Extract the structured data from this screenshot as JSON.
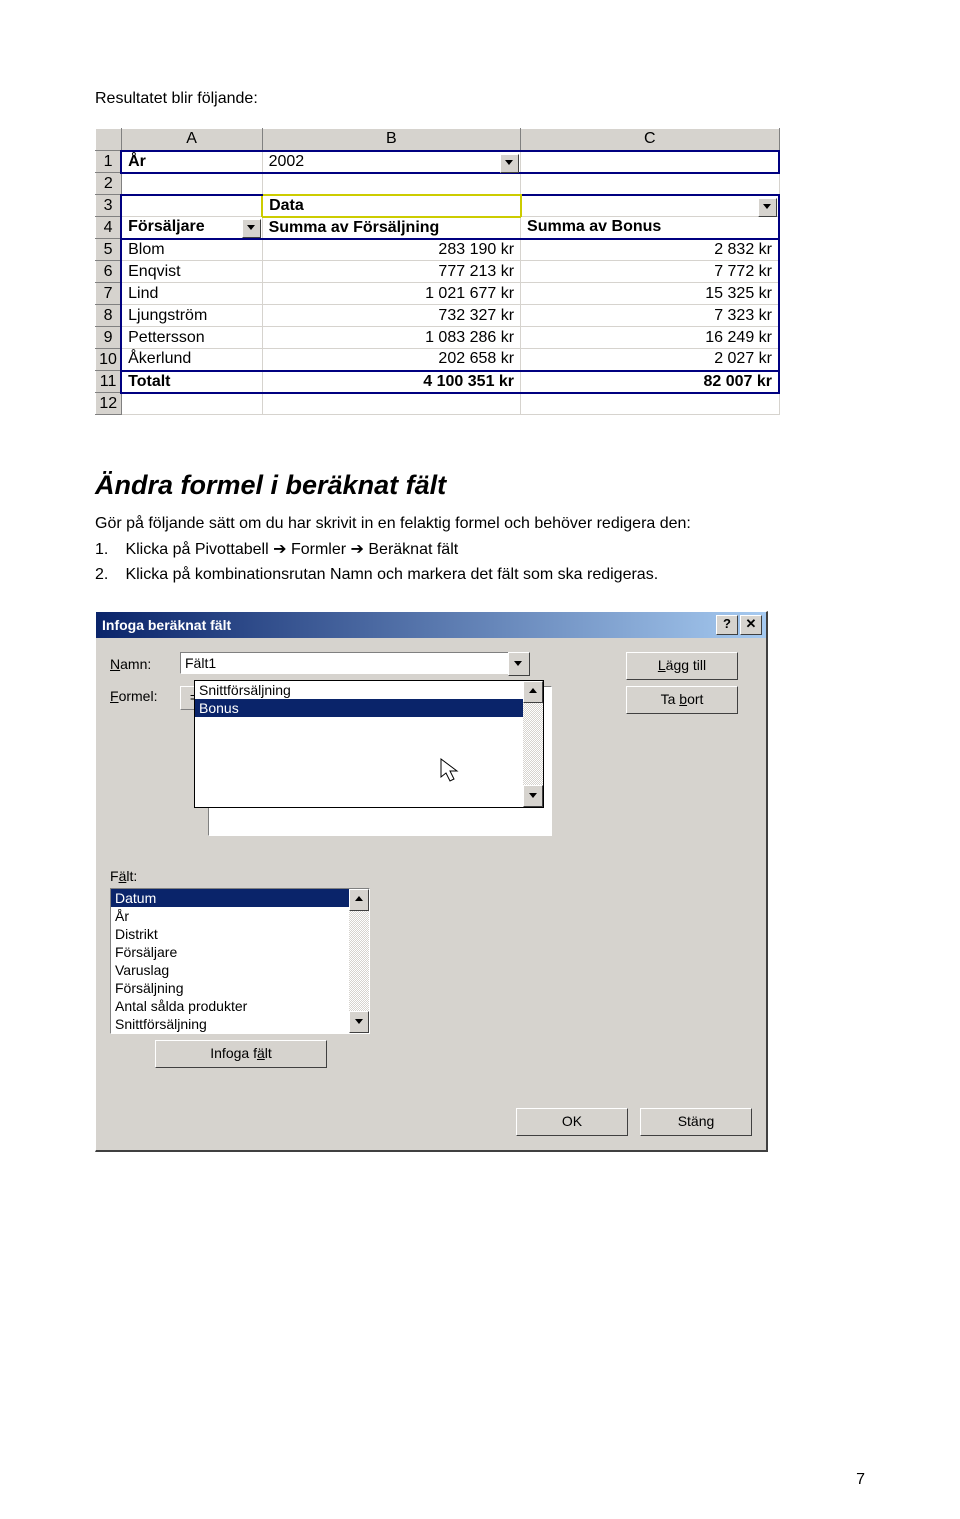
{
  "intro": "Resultatet blir följande:",
  "excel": {
    "cols": [
      "A",
      "B",
      "C"
    ],
    "rows": [
      "1",
      "2",
      "3",
      "4",
      "5",
      "6",
      "7",
      "8",
      "9",
      "10",
      "11",
      "12"
    ],
    "r1": {
      "a": "År",
      "b": "2002"
    },
    "r3": {
      "b": "Data"
    },
    "r4": {
      "a": "Försäljare",
      "b": "Summa av Försäljning",
      "c": "Summa av Bonus"
    },
    "data": [
      {
        "name": "Blom",
        "sales": "283 190 kr",
        "bonus": "2 832 kr"
      },
      {
        "name": "Enqvist",
        "sales": "777 213 kr",
        "bonus": "7 772 kr"
      },
      {
        "name": "Lind",
        "sales": "1 021 677 kr",
        "bonus": "15 325 kr"
      },
      {
        "name": "Ljungström",
        "sales": "732 327 kr",
        "bonus": "7 323 kr"
      },
      {
        "name": "Pettersson",
        "sales": "1 083 286 kr",
        "bonus": "16 249 kr"
      },
      {
        "name": "Åkerlund",
        "sales": "202 658 kr",
        "bonus": "2 027 kr"
      }
    ],
    "total": {
      "name": "Totalt",
      "sales": "4 100 351 kr",
      "bonus": "82 007 kr"
    }
  },
  "heading": "Ändra formel i beräknat fält",
  "para_intro": "Gör på följande sätt om du har skrivit in en felaktig formel och behöver redigera den:",
  "step1_a": "Klicka på Pivottabell ",
  "step1_b": " Formler ",
  "step1_c": " Beräknat fält",
  "step2": "Klicka på kombinationsrutan Namn och markera det fält som ska redigeras.",
  "arrow": "➔",
  "dialog": {
    "title": "Infoga beräknat fält",
    "help_btn": "?",
    "close_btn": "✕",
    "lbl_name": "Namn:",
    "name_value": "Fält1",
    "lbl_formel": "Formel:",
    "eq": "=",
    "dd_items": [
      "Snittförsäljning",
      "Bonus"
    ],
    "dd_sel_index": 1,
    "lbl_falt": "Fält:",
    "falt_items": [
      "Datum",
      "År",
      "Distrikt",
      "Försäljare",
      "Varuslag",
      "Försäljning",
      "Antal sålda produkter",
      "Snittförsäljning"
    ],
    "btn_add": "Lägg till",
    "btn_del_pre": "Ta ",
    "btn_del_u": "b",
    "btn_del_post": "ort",
    "btn_insert_pre": "Infoga f",
    "btn_insert_u": "ä",
    "btn_insert_post": "lt",
    "btn_ok": "OK",
    "btn_close": "Stäng"
  },
  "page_number": "7"
}
